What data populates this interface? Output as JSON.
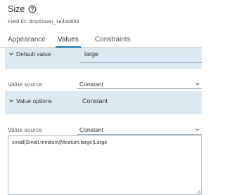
{
  "header": {
    "title": "Size",
    "field_id": "Field ID: dropDown_1e4ad8b9"
  },
  "tabs": [
    {
      "label": "Appearance",
      "active": false
    },
    {
      "label": "Values",
      "active": true
    },
    {
      "label": "Constraints",
      "active": false
    }
  ],
  "default_value": {
    "label": "Default value",
    "value": "large"
  },
  "value_source_1": {
    "label": "Value source",
    "selected": "Constant"
  },
  "value_options": {
    "label": "Value options",
    "value": "Constant"
  },
  "value_source_2": {
    "label": "Value source",
    "selected": "Constant"
  },
  "options_textarea": {
    "value": "small|Small,medium|Medium,large|Large"
  },
  "colors": {
    "section_bg": "#dde9f1",
    "active_tab_underline": "#1a73b8"
  }
}
